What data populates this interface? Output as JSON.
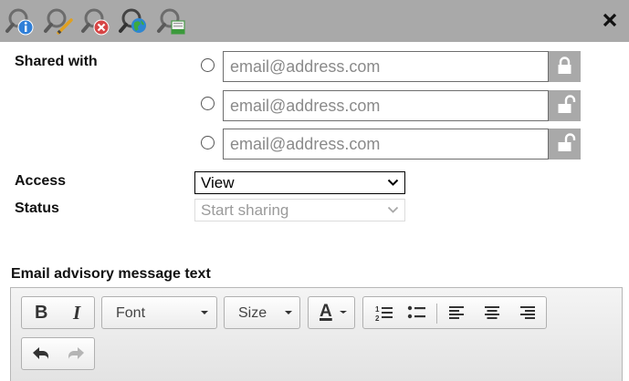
{
  "toolbar": {
    "icons": [
      "search-info-icon",
      "search-edit-icon",
      "search-remove-icon",
      "search-globe-icon",
      "search-export-icon"
    ],
    "close_label": "close"
  },
  "form": {
    "shared_with_label": "Shared with",
    "email_placeholder": "email@address.com",
    "recipients": [
      {
        "value": "",
        "selected": false,
        "locked": true
      },
      {
        "value": "",
        "selected": false,
        "locked": false
      },
      {
        "value": "",
        "selected": false,
        "locked": false
      }
    ],
    "access_label": "Access",
    "access_value": "View",
    "status_label": "Status",
    "status_value": "Start sharing",
    "status_enabled": false
  },
  "editor": {
    "label": "Email advisory message text",
    "bold": "B",
    "italic": "I",
    "font_label": "Font",
    "size_label": "Size",
    "text_color_glyph": "A"
  },
  "colors": {
    "toolbar_bg": "#a9a9a9",
    "lock_bg": "#a9a9a9"
  }
}
